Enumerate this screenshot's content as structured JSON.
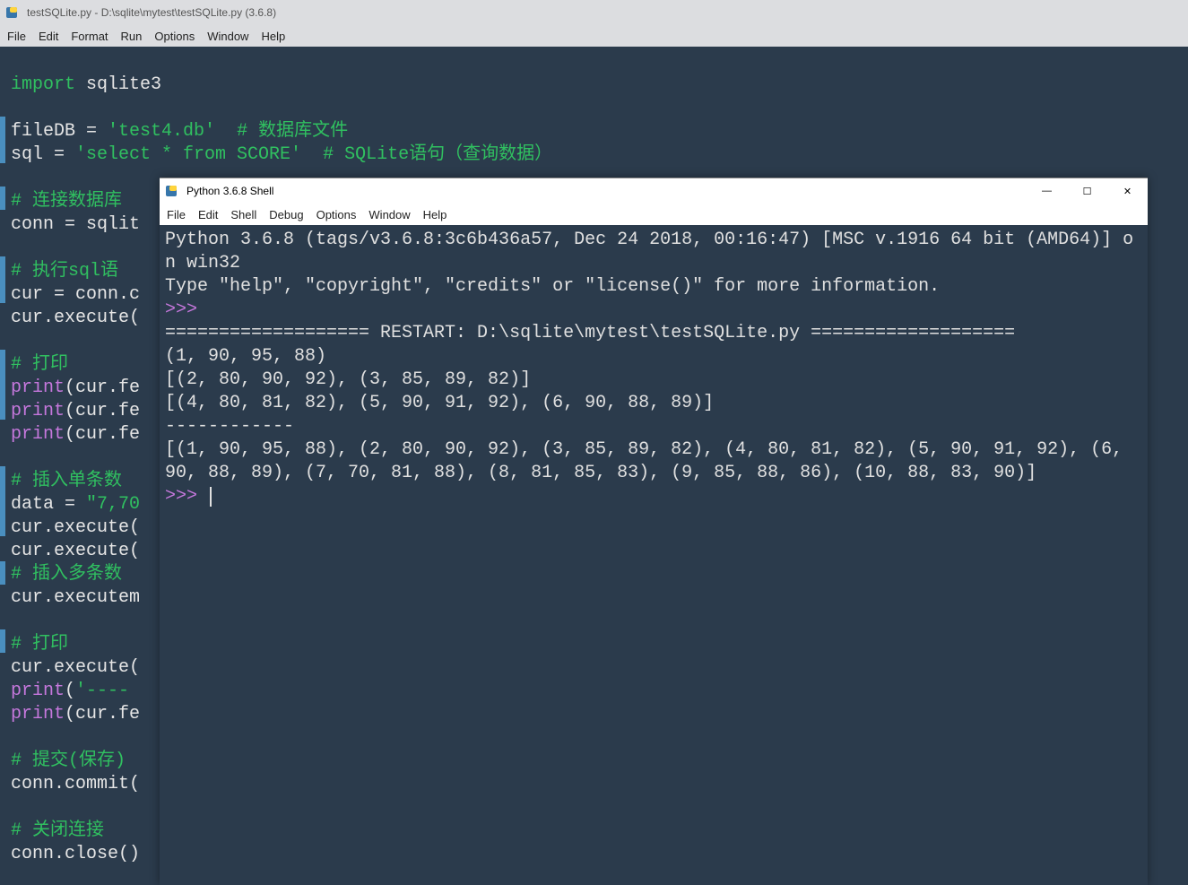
{
  "editor": {
    "title": "testSQLite.py - D:\\sqlite\\mytest\\testSQLite.py (3.6.8)",
    "menu": [
      "File",
      "Edit",
      "Format",
      "Run",
      "Options",
      "Window",
      "Help"
    ],
    "code": {
      "l1a": "import",
      "l1b": " sqlite3",
      "l2": "",
      "l3a": "fileDB = ",
      "l3b": "'test4.db'",
      "l3c": "  # 数据库文件",
      "l4a": "sql = ",
      "l4b": "'select * from SCORE'",
      "l4c": "  # SQLite语句（查询数据）",
      "l5": "",
      "l6": "# 连接数据库",
      "l7": "conn = sqlit",
      "l8": "",
      "l9": "# 执行sql语",
      "l10": "cur = conn.c",
      "l11": "cur.execute(",
      "l12": "",
      "l13": "# 打印",
      "l14a": "print",
      "l14b": "(cur.fe",
      "l15a": "print",
      "l15b": "(cur.fe",
      "l16a": "print",
      "l16b": "(cur.fe",
      "l17": "",
      "l18": "# 插入单条数",
      "l19a": "data = ",
      "l19b": "\"7,70",
      "l20": "cur.execute(",
      "l21": "cur.execute(",
      "l22": "# 插入多条数",
      "l23": "cur.executem",
      "l24": "",
      "l25": "# 打印",
      "l26": "cur.execute(",
      "l27a": "print",
      "l27b": "(",
      "l27c": "'----",
      "l28a": "print",
      "l28b": "(cur.fe",
      "l29": "",
      "l30": "# 提交(保存)",
      "l31": "conn.commit(",
      "l32": "",
      "l33": "# 关闭连接",
      "l34": "conn.close()"
    }
  },
  "shell": {
    "title": "Python 3.6.8 Shell",
    "menu": [
      "File",
      "Edit",
      "Shell",
      "Debug",
      "Options",
      "Window",
      "Help"
    ],
    "min": "—",
    "max": "☐",
    "close": "✕",
    "text": {
      "banner1": "Python 3.6.8 (tags/v3.6.8:3c6b436a57, Dec 24 2018, 00:16:47) [MSC v.1916 64 bit (AMD64)] on win32",
      "banner2": "Type \"help\", \"copyright\", \"credits\" or \"license()\" for more information.",
      "prompt1": ">>> ",
      "restart": "=================== RESTART: D:\\sqlite\\mytest\\testSQLite.py ===================",
      "out1": "(1, 90, 95, 88)",
      "out2": "[(2, 80, 90, 92), (3, 85, 89, 82)]",
      "out3": "[(4, 80, 81, 82), (5, 90, 91, 92), (6, 90, 88, 89)]",
      "out4": "------------",
      "out5": "[(1, 90, 95, 88), (2, 80, 90, 92), (3, 85, 89, 82), (4, 80, 81, 82), (5, 90, 91, 92), (6, 90, 88, 89), (7, 70, 81, 88), (8, 81, 85, 83), (9, 85, 88, 86), (10, 88, 83, 90)]",
      "prompt2": ">>> "
    }
  }
}
